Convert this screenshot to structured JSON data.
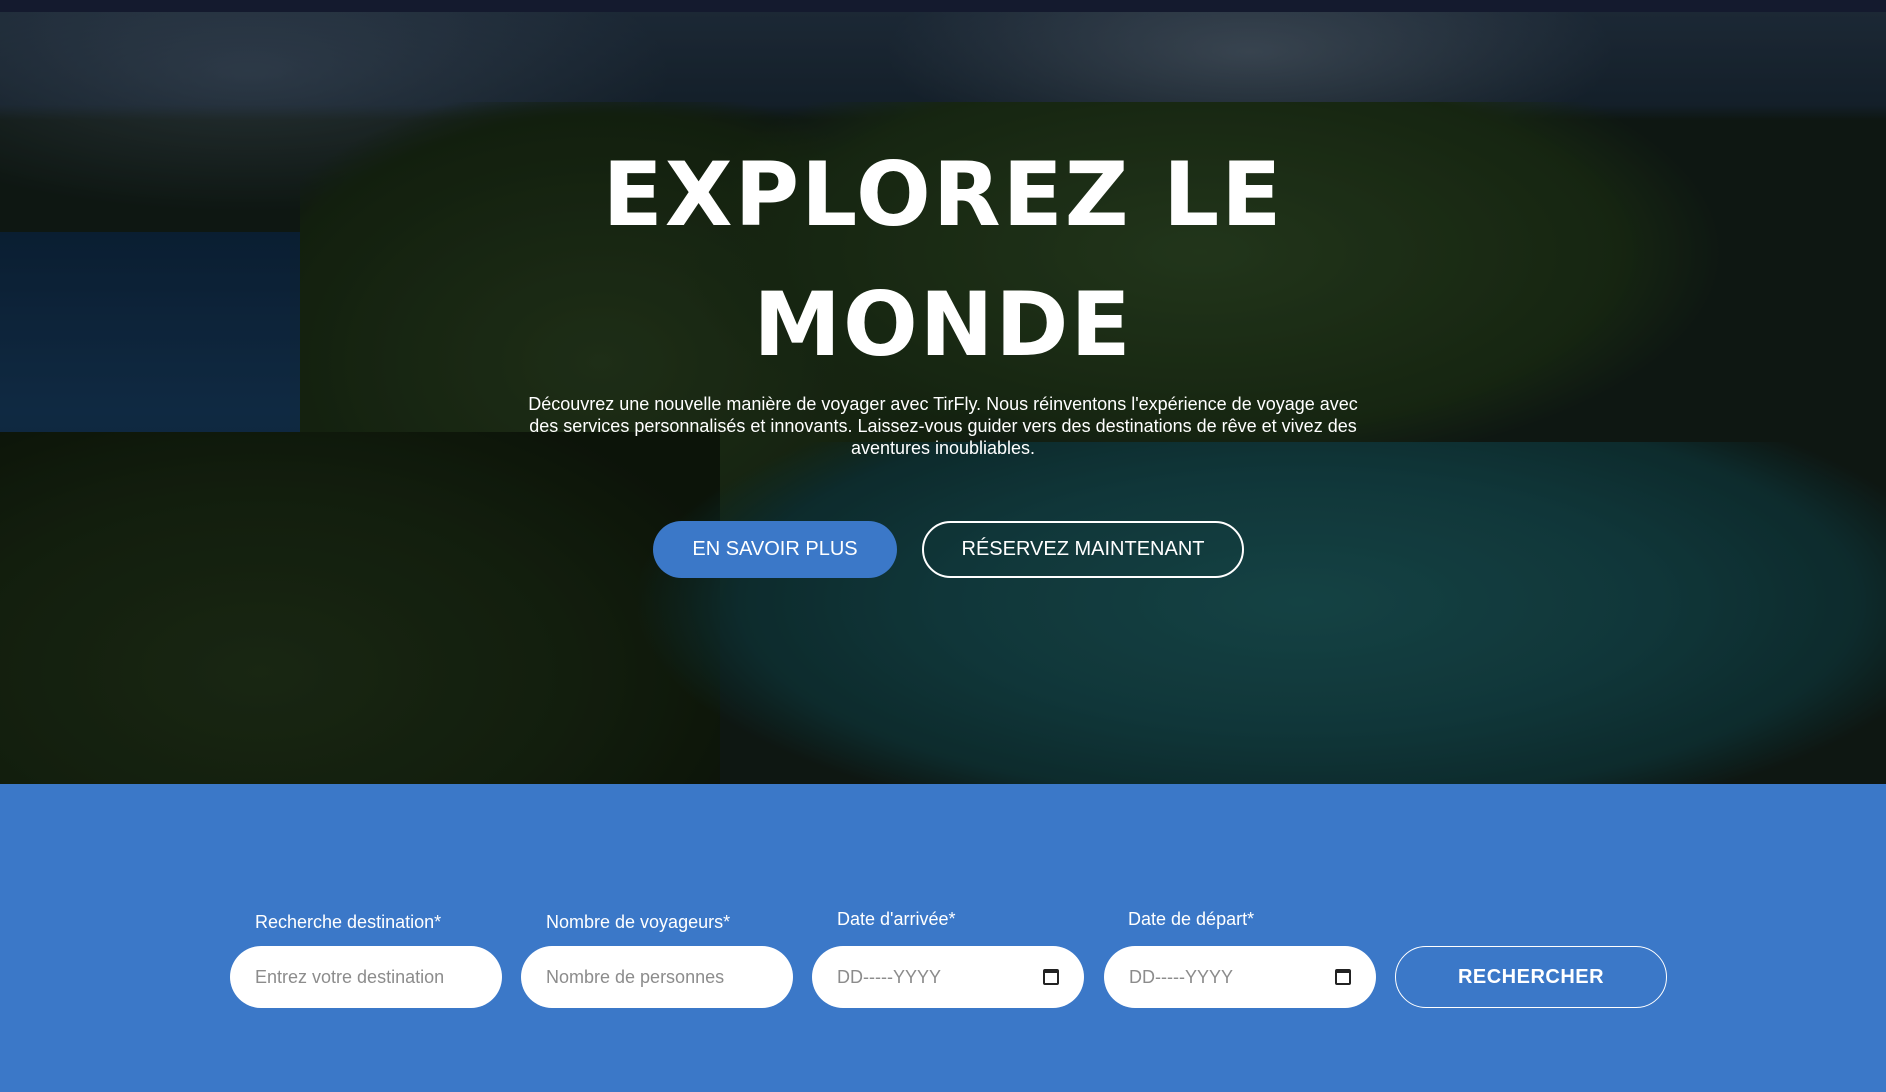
{
  "hero": {
    "title": "EXPLOREZ LE MONDE",
    "description": "Découvrez une nouvelle manière de voyager avec TirFly. Nous réinventons l'expérience de voyage avec des services personnalisés et innovants. Laissez-vous guider vers des destinations de rêve et vivez des aventures inoubliables.",
    "primary_button": "EN SAVOIR PLUS",
    "secondary_button": "RÉSERVEZ MAINTENANT"
  },
  "search": {
    "destination": {
      "label": "Recherche destination*",
      "placeholder": "Entrez votre destination"
    },
    "travelers": {
      "label": "Nombre de voyageurs*",
      "placeholder": "Nombre de personnes"
    },
    "arrival": {
      "label": "Date d'arrivée*",
      "placeholder": "DD-----YYYY",
      "icon": "calendar-icon"
    },
    "departure": {
      "label": "Date de départ*",
      "placeholder": "DD-----YYYY",
      "icon": "calendar-icon"
    },
    "submit": "RECHERCHER"
  },
  "colors": {
    "accent": "#3b78c8",
    "topbar": "#141a2e"
  }
}
